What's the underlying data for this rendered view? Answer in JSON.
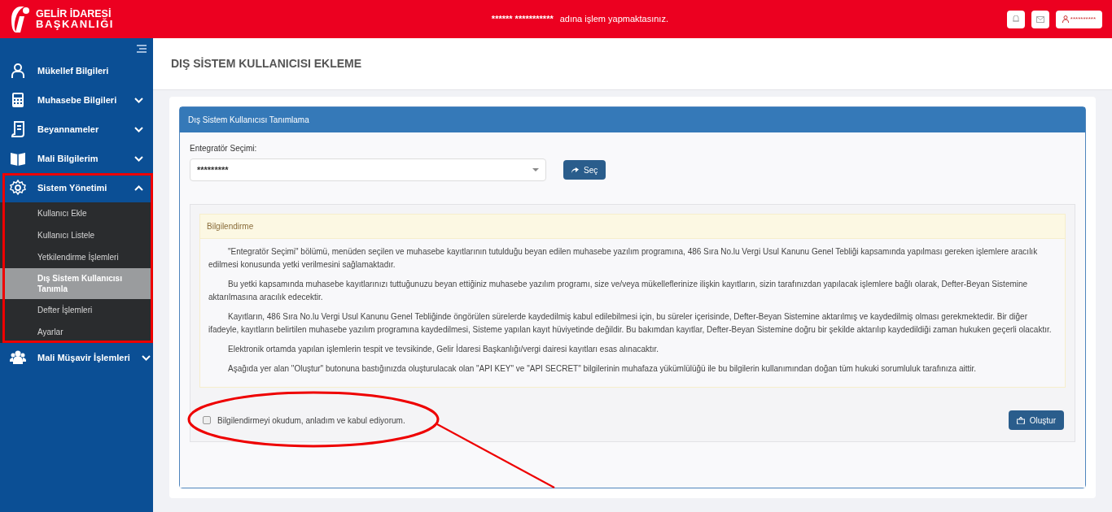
{
  "header": {
    "brand": [
      "GELİR İDARESİ",
      "BAŞKANLIĞI"
    ],
    "masked_name": "****** ***********",
    "message": "adına işlem yapmaktasınız.",
    "user": "**********"
  },
  "sidebar": {
    "items": [
      {
        "label": "Mükellef Bilgileri"
      },
      {
        "label": "Muhasebe Bilgileri",
        "expanded": false
      },
      {
        "label": "Beyannameler",
        "expanded": false
      },
      {
        "label": "Mali Bilgilerim",
        "expanded": false
      },
      {
        "label": "Sistem Yönetimi",
        "expanded": true,
        "children": [
          {
            "label": "Kullanıcı Ekle",
            "selected": false
          },
          {
            "label": "Kullanıcı Listele",
            "selected": false
          },
          {
            "label": "Yetkilendirme İşlemleri",
            "selected": false
          },
          {
            "label": "Dış Sistem Kullanıcısı Tanımla",
            "selected": true
          },
          {
            "label": "Defter İşlemleri",
            "selected": false
          },
          {
            "label": "Ayarlar",
            "selected": false
          }
        ]
      },
      {
        "label": "Mali Müşavir İşlemleri",
        "expanded": false
      }
    ]
  },
  "page_title": "DIŞ SİSTEM KULLANICISI EKLEME",
  "panel": {
    "title": "Dış Sistem Kullanıcısı Tanımlama",
    "select_label": "Entegratör Seçimi:",
    "select_value": "*********",
    "select_button": "Seç",
    "info": {
      "title": "Bilgilendirme",
      "paragraphs": [
        "\"Entegratör Seçimi\" bölümü, menüden seçilen ve muhasebe kayıtlarının tutulduğu beyan edilen muhasebe yazılım programına, 486 Sıra No.lu Vergi Usul Kanunu Genel Tebliği kapsamında yapılması gereken işlemlere aracılık edilmesi konusunda yetki verilmesini sağlamaktadır.",
        "Bu yetki kapsamında muhasebe kayıtlarınızı tuttuğunuzu beyan ettiğiniz muhasebe yazılım programı, size ve/veya mükelleflerinize ilişkin kayıtların, sizin tarafınızdan yapılacak işlemlere bağlı olarak, Defter-Beyan Sistemine aktarılmasına aracılık edecektir.",
        "Kayıtların, 486 Sıra No.lu Vergi Usul Kanunu Genel Tebliğinde öngörülen sürelerde kaydedilmiş kabul edilebilmesi için, bu süreler içerisinde, Defter-Beyan Sistemine aktarılmış ve kaydedilmiş olması gerekmektedir. Bir diğer ifadeyle, kayıtların belirtilen muhasebe yazılım programına kaydedilmesi, Sisteme yapılan kayıt hüviyetinde değildir. Bu bakımdan kayıtlar, Defter-Beyan Sistemine doğru bir şekilde aktarılıp kaydedildiği zaman hukuken geçerli olacaktır.",
        "Elektronik ortamda yapılan işlemlerin tespit ve tevsikinde, Gelir İdaresi Başkanlığı/vergi dairesi kayıtları esas alınacaktır.",
        "Aşağıda yer alan \"Oluştur\" butonuna bastığınızda oluşturulacak olan \"API KEY\" ve \"API SECRET\" bilgilerinin muhafaza yükümlülüğü ile bu bilgilerin kullanımından doğan tüm hukuki sorumluluk tarafınıza aittir."
      ]
    },
    "consent": {
      "label": "Bilgilendirmeyi okudum, anladım ve kabul ediyorum.",
      "checked": false
    },
    "create_button": "Oluştur"
  }
}
